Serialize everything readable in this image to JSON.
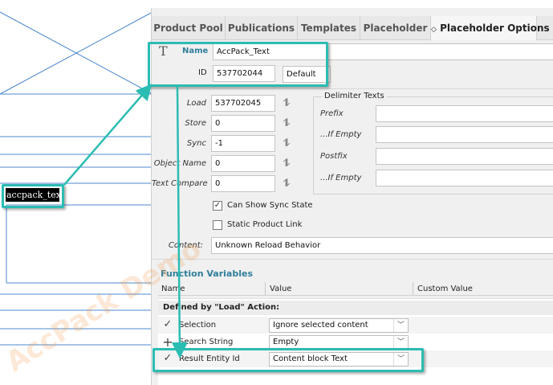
{
  "canvas": {
    "selected_text": "accpack_text"
  },
  "tabs": [
    {
      "label": "Product Pool"
    },
    {
      "label": "Publications"
    },
    {
      "label": "Templates"
    },
    {
      "label": "Placeholder"
    },
    {
      "label": "Placeholder Options"
    }
  ],
  "active_tab_chevron": "◇",
  "header": {
    "name_label": "Name",
    "name_value": "AccPack_Text",
    "id_label": "ID",
    "id_value": "537702044",
    "id_default": "Default"
  },
  "fields": {
    "load_label": "Load",
    "load_value": "537702045",
    "store_label": "Store",
    "store_value": "0",
    "sync_label": "Sync",
    "sync_value": "-1",
    "object_name_label": "Object Name",
    "object_name_value": "0",
    "text_compare_label": "Text Compare",
    "text_compare_value": "0"
  },
  "delimiter": {
    "title": "Delimiter Texts",
    "prefix_label": "Prefix",
    "prefix_if_empty_label": "...If Empty",
    "postfix_label": "Postfix",
    "postfix_if_empty_label": "...If Empty"
  },
  "checks": {
    "can_show_sync_state": "Can Show Sync State",
    "can_show_sync_state_checked": true,
    "static_product_link": "Static Product Link",
    "static_product_link_checked": false
  },
  "content": {
    "label": "Content:",
    "value": "Unknown Reload Behavior"
  },
  "function_variables": {
    "title": "Function Variables",
    "columns": [
      "Name",
      "Value",
      "Custom Value"
    ],
    "group_label": "Defined by \"Load\" Action:",
    "rows": [
      {
        "mark": "✓",
        "name": "Selection",
        "value": "Ignore selected content"
      },
      {
        "mark": "+",
        "name": "Search String",
        "value": "Empty"
      },
      {
        "mark": "✓",
        "name": "Result Entity Id",
        "value": "Content block Text"
      }
    ]
  },
  "watermark": "AccPack Demo",
  "colors": {
    "highlight": "#2bbcb3",
    "section_title": "#2f7f9a",
    "watermark": "#f0963e"
  }
}
